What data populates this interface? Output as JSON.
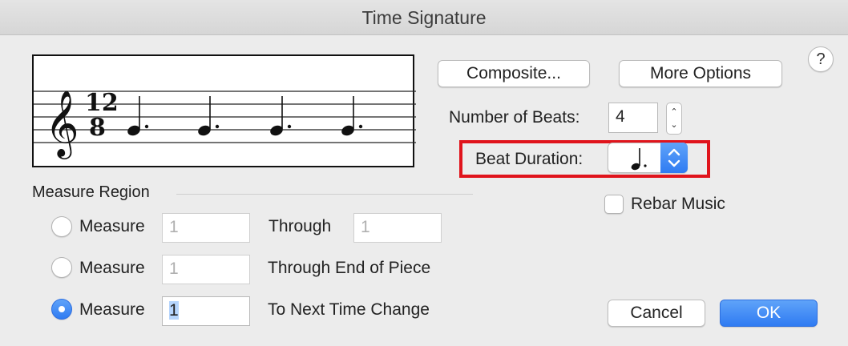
{
  "window": {
    "title": "Time Signature",
    "help_label": "?"
  },
  "preview": {
    "clef": "𝄞",
    "numerator": "12",
    "denominator": "8",
    "note_count": 4
  },
  "buttons": {
    "composite": "Composite...",
    "more_options": "More Options",
    "cancel": "Cancel",
    "ok": "OK"
  },
  "beats": {
    "label": "Number of Beats:",
    "value": "4"
  },
  "beat_duration": {
    "label": "Beat Duration:",
    "value": "dotted-quarter-note-icon"
  },
  "rebar": {
    "label": "Rebar Music",
    "checked": false
  },
  "measure_region": {
    "title": "Measure Region",
    "options": [
      {
        "label": "Measure",
        "from": "1",
        "through_label": "Through",
        "through": "1",
        "selected": false
      },
      {
        "label": "Measure",
        "from": "1",
        "through_label": "Through End of Piece",
        "selected": false
      },
      {
        "label": "Measure",
        "from": "1",
        "through_label": "To Next Time Change",
        "selected": true
      }
    ]
  },
  "colors": {
    "accent": "#2f7bf2",
    "highlight": "#e0141c",
    "background": "#ececec"
  }
}
